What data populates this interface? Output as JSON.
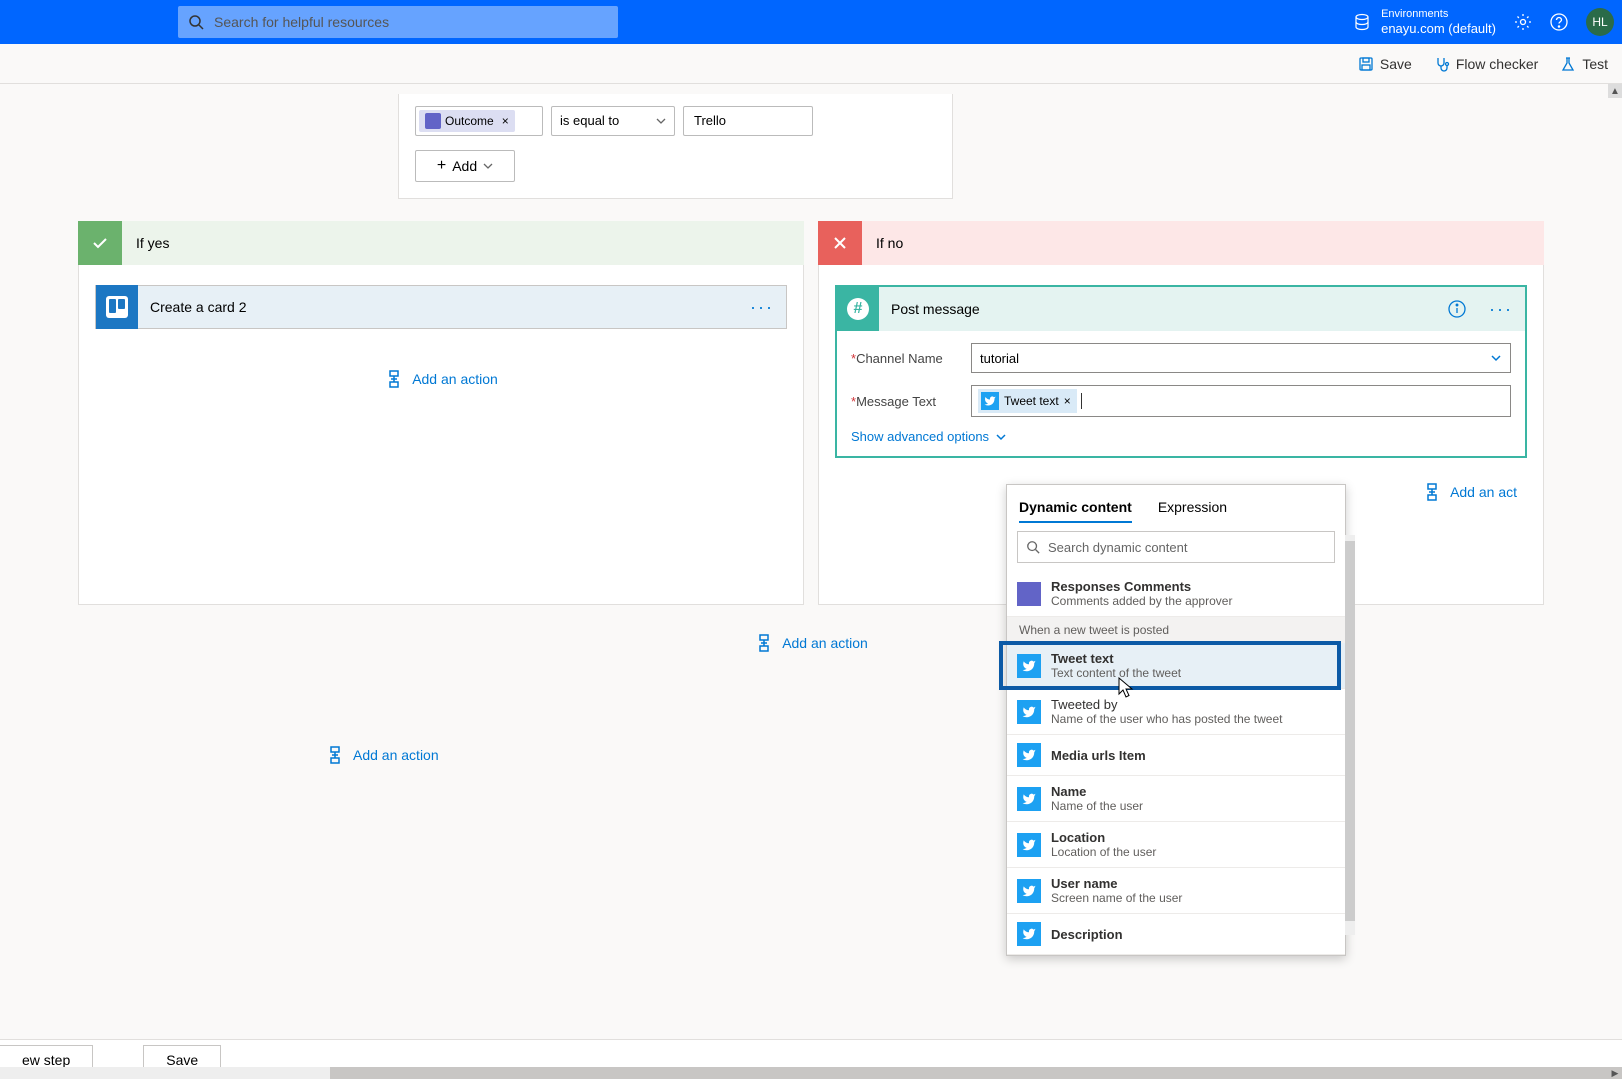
{
  "header": {
    "search_placeholder": "Search for helpful resources",
    "env_label": "Environments",
    "env_name": "enayu.com (default)",
    "avatar_initials": "HL"
  },
  "toolbar": {
    "save": "Save",
    "checker": "Flow checker",
    "test": "Test"
  },
  "condition": {
    "pill_label": "Outcome",
    "operator": "is equal to",
    "value": "Trello",
    "add_button": "Add"
  },
  "branches": {
    "yes_label": "If yes",
    "no_label": "If no",
    "trello_action_title": "Create a card 2",
    "add_action": "Add an action",
    "add_action_short": "Add an act"
  },
  "slack": {
    "title": "Post message",
    "channel_label": "Channel Name",
    "channel_value": "tutorial",
    "message_label": "Message Text",
    "token_label": "Tweet text",
    "advanced": "Show advanced options"
  },
  "popup": {
    "tab_dynamic": "Dynamic content",
    "tab_expression": "Expression",
    "search_placeholder": "Search dynamic content",
    "responses_title": "Responses Comments",
    "responses_sub": "Comments added by the approver",
    "group_tweet": "When a new tweet is posted",
    "items": [
      {
        "title": "Tweet text",
        "sub": "Text content of the tweet"
      },
      {
        "title": "Tweeted by",
        "sub": "Name of the user who has posted the tweet"
      },
      {
        "title": "Media urls Item",
        "sub": ""
      },
      {
        "title": "Name",
        "sub": "Name of the user"
      },
      {
        "title": "Location",
        "sub": "Location of the user"
      },
      {
        "title": "User name",
        "sub": "Screen name of the user"
      },
      {
        "title": "Description",
        "sub": ""
      }
    ]
  },
  "bottom": {
    "new_step": "ew step",
    "save": "Save"
  }
}
